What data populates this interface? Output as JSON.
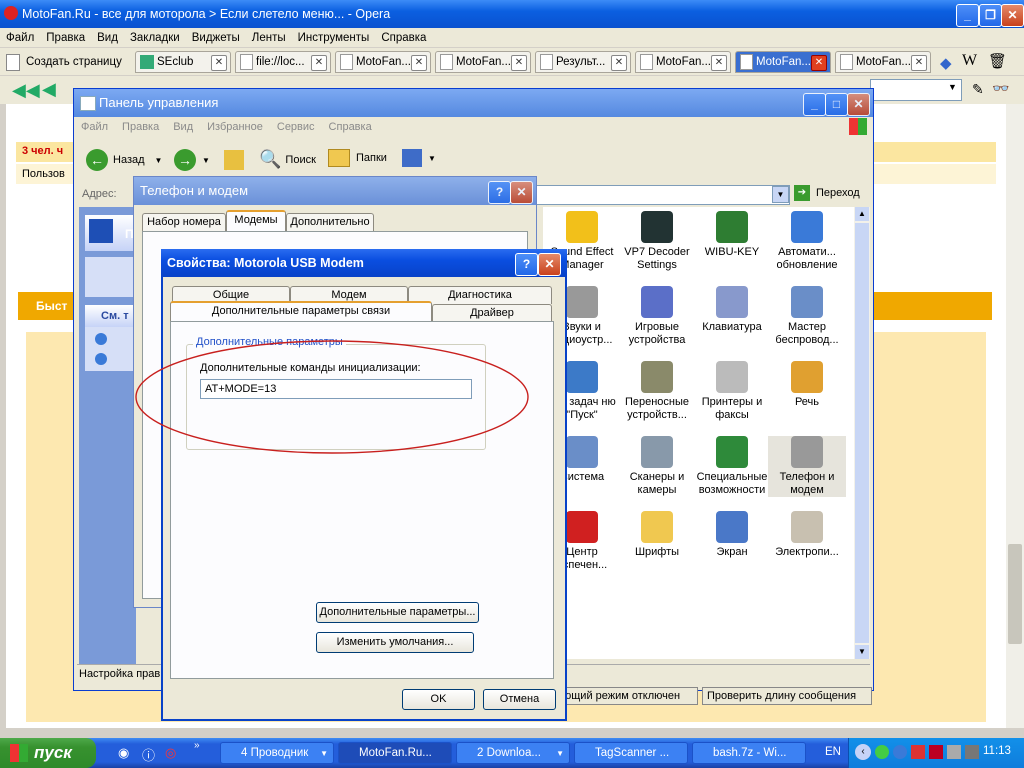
{
  "opera": {
    "title": "MotoFan.Ru - все для моторола > Если слетело меню... - Opera",
    "menu": [
      "Файл",
      "Правка",
      "Вид",
      "Закладки",
      "Виджеты",
      "Ленты",
      "Инструменты",
      "Справка"
    ],
    "new_page_label": "Создать страницу",
    "tabs": [
      {
        "label": "SEclub",
        "active": false
      },
      {
        "label": "file://loc...",
        "active": false
      },
      {
        "label": "MotoFan...",
        "active": false
      },
      {
        "label": "MotoFan...",
        "active": false
      },
      {
        "label": "Результ...",
        "active": false
      },
      {
        "label": "MotoFan...",
        "active": false
      },
      {
        "label": "MotoFan...",
        "active": true
      },
      {
        "label": "MotoFan...",
        "active": false
      }
    ]
  },
  "page": {
    "users_label": "3 чел. ч",
    "users_sub": "Пользов",
    "quick_label": "Быст",
    "bottom_status_left": "ющий режим отключен",
    "bottom_status_right": "Проверить длину сообщения"
  },
  "control_panel": {
    "title": "Панель управления",
    "menu": [
      "Файл",
      "Правка",
      "Вид",
      "Избранное",
      "Сервис",
      "Справка"
    ],
    "toolbar": {
      "back": "Назад",
      "search": "Поиск",
      "folders": "Папки"
    },
    "address_label": "Адрес:",
    "go_label": "Переход",
    "left_panel_title": "П",
    "see_also": "См. т",
    "status": "Настройка прави",
    "icons": [
      {
        "label": "Sound Effect Manager",
        "icon": "sound-effect-icon"
      },
      {
        "label": "VP7 Decoder Settings",
        "icon": "on2-icon"
      },
      {
        "label": "WIBU-KEY",
        "icon": "wibu-key-icon"
      },
      {
        "label": "Автомати... обновление",
        "icon": "globe-update-icon"
      },
      {
        "label": "Звуки и аудиоустр...",
        "icon": "speaker-icon"
      },
      {
        "label": "Игровые устройства",
        "icon": "gamepad-icon"
      },
      {
        "label": "Клавиатура",
        "icon": "keyboard-icon"
      },
      {
        "label": "Мастер беспровод...",
        "icon": "wireless-icon"
      },
      {
        "label": "ель задач ню \"Пуск\"",
        "icon": "taskbar-icon"
      },
      {
        "label": "Переносные устройств...",
        "icon": "portable-device-icon"
      },
      {
        "label": "Принтеры и факсы",
        "icon": "printer-icon"
      },
      {
        "label": "Речь",
        "icon": "speech-icon"
      },
      {
        "label": "Система",
        "icon": "system-icon"
      },
      {
        "label": "Сканеры и камеры",
        "icon": "scanner-icon"
      },
      {
        "label": "Специальные возможности",
        "icon": "accessibility-icon"
      },
      {
        "label": "Телефон и модем",
        "icon": "phone-modem-icon"
      },
      {
        "label": "Центр еспечен...",
        "icon": "security-shield-icon"
      },
      {
        "label": "Шрифты",
        "icon": "fonts-folder-icon"
      },
      {
        "label": "Экран",
        "icon": "display-icon"
      },
      {
        "label": "Электропи...",
        "icon": "power-icon"
      }
    ]
  },
  "phone_modem": {
    "title": "Телефон и модем",
    "tabs": [
      "Набор номера",
      "Модемы",
      "Дополнительно"
    ]
  },
  "dialog": {
    "title": "Свойства: Motorola USB Modem",
    "tabs_row1": [
      "Общие",
      "Модем",
      "Диагностика"
    ],
    "tabs_row2": [
      "Дополнительные параметры связи",
      "Драйвер"
    ],
    "group_label": "Дополнительные параметры",
    "init_label": "Дополнительные команды инициализации:",
    "init_value": "AT+MODE=13",
    "adv_button": "Дополнительные параметры...",
    "defaults_button": "Изменить умолчания...",
    "ok": "OK",
    "cancel": "Отмена"
  },
  "taskbar": {
    "start": "пуск",
    "items": [
      "4 Проводник",
      "MotoFan.Ru...",
      "2 Downloa...",
      "TagScanner ...",
      "bash.7z - Wi..."
    ],
    "lang": "EN",
    "time": "11:13"
  },
  "colors": {
    "xp_blue": "#0842c8",
    "annotation_red": "#c8201e",
    "start_green": "#3a9b2e"
  }
}
